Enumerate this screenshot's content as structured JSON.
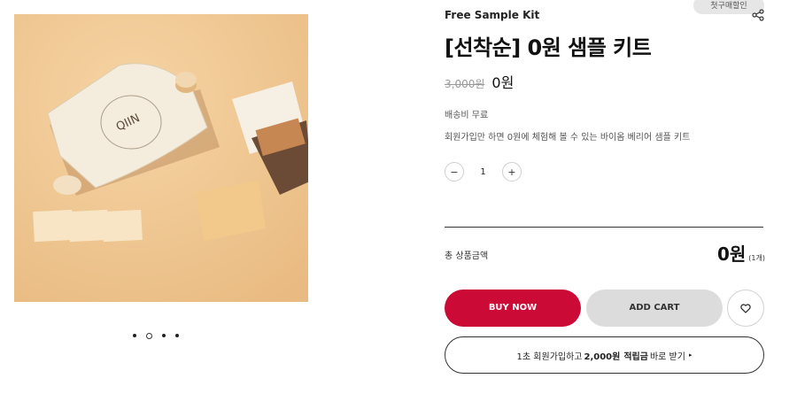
{
  "gallery": {
    "brand_text": "QIIN",
    "slide_count": 4,
    "active_slide": 2
  },
  "product": {
    "subtitle": "Free Sample Kit",
    "badge": "첫구매할인",
    "title": "[선착순] 0원 샘플 키트",
    "original_price": "3,000원",
    "sale_price": "0원",
    "shipping": "배송비 무료",
    "description": "회원가입만 하면 0원에 체험해 볼 수 있는 바이옴 베리어 샘플 키트"
  },
  "quantity": {
    "minus": "−",
    "value": "1",
    "plus": "+"
  },
  "total": {
    "label": "총 상품금액",
    "price": "0원",
    "count": "(1개)"
  },
  "actions": {
    "buy_now": "BUY NOW",
    "add_cart": "ADD CART"
  },
  "signup_banner": {
    "prefix": "1초 회원가입하고",
    "amount": "2,000원",
    "points": "적립금",
    "suffix": "바로 받기",
    "arrow": "▸"
  },
  "colors": {
    "buy_now_bg": "#cc0a36",
    "add_cart_bg": "#dcdcdc",
    "photo_bg": "#f0c995"
  },
  "icons": [
    "share-icon",
    "heart-icon",
    "chevron-right-icon"
  ]
}
